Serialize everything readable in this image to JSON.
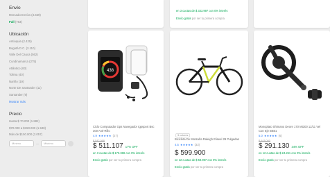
{
  "sidebar": {
    "envio_title": "Envío",
    "envio_item": "Mercado Envíos (3.659)",
    "full_label": "Full",
    "full_count": "(753)",
    "ubicacion_title": "Ubicación",
    "locations": [
      "Antioquia (2.425)",
      "Bogotá D.C. (2.110)",
      "Valle Del Cauca (562)",
      "Cundinamarca (275)",
      "Atlántico (83)",
      "Tolima (40)",
      "Nariño (19)",
      "Norte De Santander (11)",
      "Santander (9)"
    ],
    "show_more": "Mostrar más",
    "precio_title": "Precio",
    "prices": [
      "Hasta $ 70.000 (1.882)",
      "$70.000 a $150.000 (1.948)",
      "Más de $150.000 (2.057)"
    ],
    "min_placeholder": "Mínimo",
    "max_placeholder": "Máximo",
    "dash": "—"
  },
  "top_cards": [
    {
      "installments": "",
      "shipping_label": "",
      "shipping_rest": ""
    },
    {
      "installments": "en 3 cuotas de $ 333.997 con 0% interés",
      "shipping_label": "Envío gratis",
      "shipping_rest": "por ser tu primera compra"
    },
    {
      "installments": "",
      "shipping_label": "",
      "shipping_rest": ""
    }
  ],
  "products": [
    {
      "title": "Ciclo Computador Gps Navegador Igpsport Bsc 300 Anti-Rillo",
      "stars": "★★★★★",
      "rating": "4.9",
      "reviews": "(27)",
      "old_price": "$ 542.099",
      "price": "$ 511.107",
      "discount": "17% OFF",
      "installments": "en 3 cuotas de $ 170.369 con 0% interés",
      "shipping_label": "Envío gratis",
      "shipping_rest": "por ser tu primera compra",
      "badge": ""
    },
    {
      "title": "Bicicleta De Montaña Raleigh Eliseel 29 Pulgadas",
      "stars": "★★★★★",
      "rating": "4.5",
      "reviews": "(33)",
      "old_price": "",
      "price": "$ 599.900",
      "discount": "",
      "installments": "en 12 cuotas de $ 59.997 con 0% interés",
      "shipping_label": "Envío gratis",
      "shipping_rest": "por ser tu primera compra",
      "badge": "3 colores"
    },
    {
      "title": "Monoplato Shimano Deore 170 Mt300 12/11 Vel Con Eje BB51",
      "stars": "★★★★★",
      "rating": "5.0",
      "reviews": "(6)",
      "old_price": "$ 443.000",
      "price": "$ 291.130",
      "discount": "34% OFF",
      "installments": "en 12 cuotas de $ 24.261 con 0% interés",
      "shipping_label": "Envío gratis",
      "shipping_rest": "por ser tu primera compra",
      "badge": ""
    }
  ]
}
